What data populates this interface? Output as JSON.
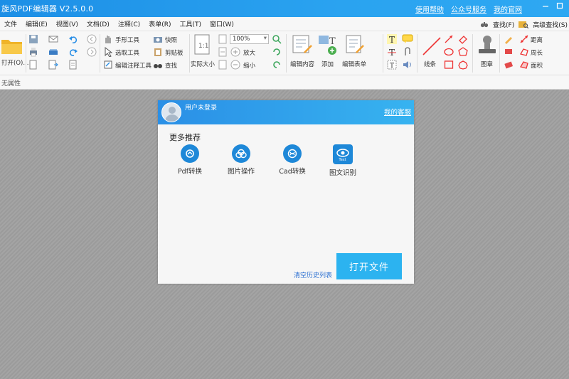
{
  "app": {
    "title": "旋风PDF编辑器 V2.5.0.0",
    "links": [
      "使用帮助",
      "公众号服务",
      "我的官网"
    ],
    "window_controls": [
      "minimize",
      "maximize"
    ]
  },
  "menu": {
    "items": [
      "文件",
      "编辑(E)",
      "视图(V)",
      "文档(D)",
      "注释(C)",
      "表单(R)",
      "工具(T)",
      "窗口(W)"
    ],
    "right_items": [
      "查找(F)",
      "高级查找(S)"
    ]
  },
  "ribbon": {
    "open_label": "打开(O)...",
    "hand_tool": "手形工具",
    "select_tool": "选取工具",
    "edit_annot_tool": "编辑注释工具",
    "snapshot": "快照",
    "clipboard": "剪贴板",
    "find": "查找",
    "actual_size": "实际大小",
    "zoom_value": "100%",
    "zoom_in": "放大",
    "zoom_out": "缩小",
    "edit_content": "编辑内容",
    "add": "添加",
    "edit_form": "编辑表单",
    "lines": "线条",
    "stamp": "图章",
    "distance": "距离",
    "perimeter": "周长",
    "area": "面积"
  },
  "propbar": {
    "label": "无属性"
  },
  "panel": {
    "user_label": "用户未登录",
    "service_link": "我的客服",
    "section_title": "更多推荐",
    "recommendations": [
      {
        "label": "Pdf转换",
        "icon": "pdf-convert-icon"
      },
      {
        "label": "图片操作",
        "icon": "image-ops-icon"
      },
      {
        "label": "Cad转换",
        "icon": "cad-convert-icon"
      },
      {
        "label": "图文识别",
        "icon": "ocr-eye-icon",
        "badge": "Text"
      }
    ],
    "clear_history": "清空历史列表",
    "open_file_button": "打开文件"
  },
  "colors": {
    "titlebar": "#2aa3f0",
    "accent_blue": "#1e88d8",
    "open_button": "#2cb3f0",
    "link_blue": "#2a6fd1"
  }
}
